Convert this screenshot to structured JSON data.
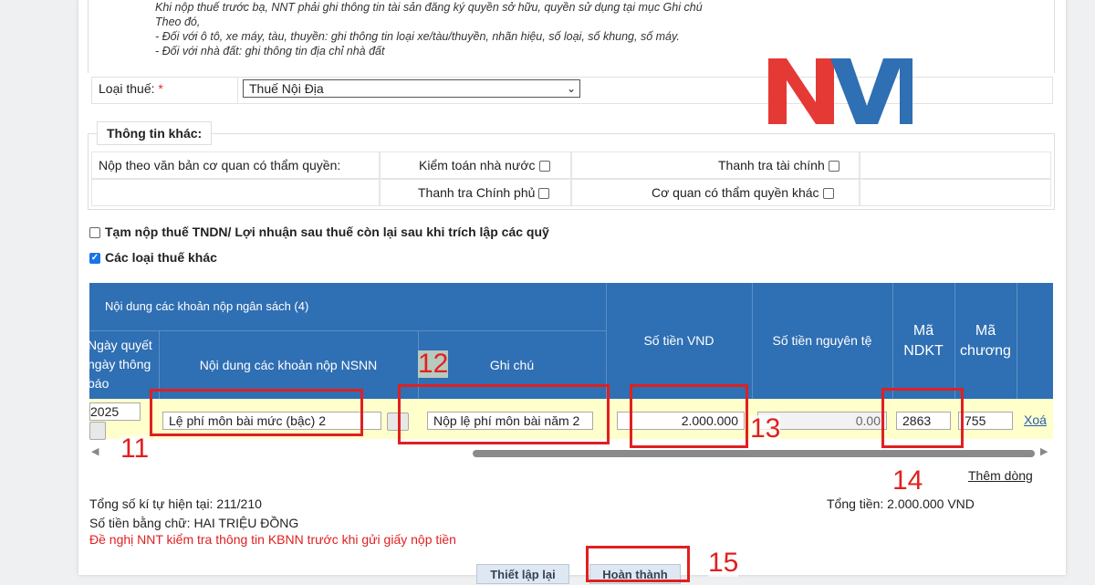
{
  "notes": {
    "line1": "Khi nộp thuế trước bạ, NNT phải ghi thông tin tài sản đăng ký quyền sở hữu, quyền sử dụng tại mục Ghi chú",
    "line2": "Theo đó,",
    "line3": "- Đối với ô tô, xe máy, tàu, thuyền: ghi thông tin loại xe/tàu/thuyền, nhãn hiệu, số loại, số khung, số máy.",
    "line4": "- Đối với nhà đất: ghi thông tin địa chỉ nhà đất"
  },
  "tax_type": {
    "label": "Loại thuế:",
    "required_mark": "*",
    "selected": "Thuế Nội Địa"
  },
  "other_info": {
    "legend": "Thông tin khác:",
    "submit_by_doc_label": "Nộp theo văn bản cơ quan có thẩm quyền:",
    "options": [
      {
        "label": "Kiểm toán nhà nước",
        "checked": false
      },
      {
        "label": "Thanh tra tài chính",
        "checked": false
      },
      {
        "label": "Thanh tra Chính phủ",
        "checked": false
      },
      {
        "label": "Cơ quan có thẩm quyền khác",
        "checked": false
      }
    ]
  },
  "checkboxes": {
    "tndn_label": "Tạm nộp thuế TNDN/ Lợi nhuận sau thuế còn lại sau khi trích lập các quỹ",
    "tndn_checked": false,
    "other_taxes_label": "Các loại thuế khác",
    "other_taxes_checked": true
  },
  "table": {
    "group_header": "Nội dung các khoản nộp ngân sách (4)",
    "headers": {
      "date_col": "Ngày quyết\nngày thông\nbáo",
      "content": "Nội dung các khoản nộp NSNN",
      "note": "Ghi chú",
      "amount_vnd": "Số tiền VND",
      "amount_fc": "Số tiền nguyên tệ",
      "ndkt": "Mã\nNDKT",
      "chapter": "Mã\nchương"
    },
    "row": {
      "date": "2025",
      "content": "Lệ phí môn bài mức (bậc) 2",
      "note": "Nộp lệ phí môn bài năm 2",
      "amount_vnd": "2.000.000",
      "amount_fc": "0.00",
      "ndkt": "2863",
      "chapter": "755",
      "delete": "Xoá"
    },
    "add_row": "Thêm dòng"
  },
  "annotations": [
    "11",
    "12",
    "13",
    "14",
    "15"
  ],
  "summary": {
    "char_count": "Tổng số kí tự hiện tại: 211/210",
    "total": "Tổng tiền: 2.000.000 VND",
    "in_words": "Số tiền bằng chữ: HAI TRIỆU ĐỒNG",
    "warning": "Đề nghị NNT kiểm tra thông tin KBNN trước khi gửi giấy nộp tiền"
  },
  "buttons": {
    "reset": "Thiết lập lại",
    "complete": "Hoàn thành"
  },
  "logo": {
    "text": "NVI",
    "color_n": "#e53935",
    "color_vi": "#2f6fb3"
  },
  "colors": {
    "header_bg": "#2f6fb3",
    "row_bg": "#ffffcc",
    "annotation_red": "#e02020",
    "warning_red": "#e02020"
  }
}
